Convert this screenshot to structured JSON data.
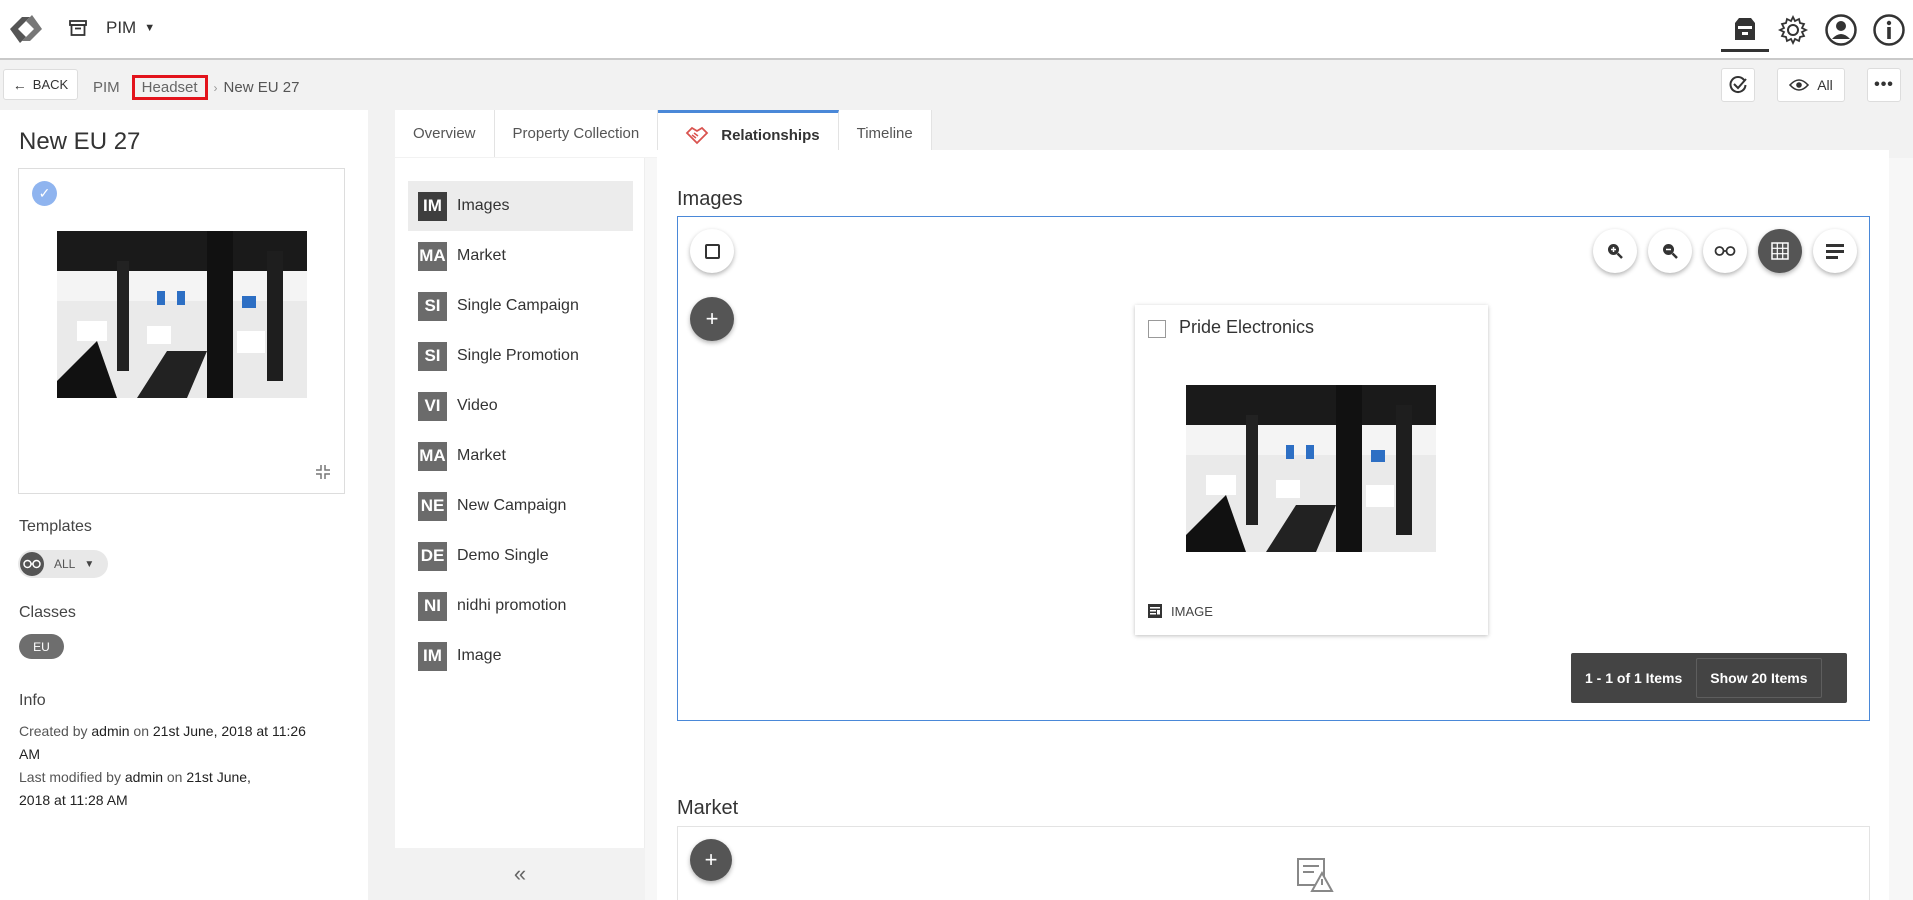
{
  "app": {
    "module": "PIM",
    "top_icons": [
      "inbox-tray-icon",
      "gear-icon",
      "user-icon",
      "info-icon"
    ]
  },
  "breadcrumb": {
    "back_label": "BACK",
    "items": [
      "PIM",
      "Headset",
      "New EU 27"
    ],
    "view_label": "All"
  },
  "left": {
    "title": "New EU 27",
    "templates_label": "Templates",
    "template_value": "ALL",
    "classes_label": "Classes",
    "class_value": "EU",
    "info_label": "Info",
    "created_prefix": "Created by",
    "created_by": "admin",
    "created_on": "on",
    "created_date": "21st June, 2018 at 11:26",
    "created_date_tail": "AM",
    "modified_prefix": "Last modified by",
    "modified_by": "admin",
    "modified_on": "on",
    "modified_date": "21st June,",
    "modified_date_tail": "2018 at 11:28 AM"
  },
  "tabs": [
    "Overview",
    "Property Collection",
    "Relationships",
    "Timeline"
  ],
  "relationships": [
    {
      "abbr": "IM",
      "name": "Images"
    },
    {
      "abbr": "MA",
      "name": "Market"
    },
    {
      "abbr": "SI",
      "name": "Single Campaign"
    },
    {
      "abbr": "SI",
      "name": "Single Promotion"
    },
    {
      "abbr": "VI",
      "name": "Video"
    },
    {
      "abbr": "MA",
      "name": "Market"
    },
    {
      "abbr": "NE",
      "name": "New Campaign"
    },
    {
      "abbr": "DE",
      "name": "Demo Single"
    },
    {
      "abbr": "NI",
      "name": "nidhi promotion"
    },
    {
      "abbr": "IM",
      "name": "Image"
    }
  ],
  "images_section": {
    "title": "Images",
    "card": {
      "title": "Pride Electronics",
      "type": "IMAGE"
    },
    "pager_count": "1 - 1 of 1 Items",
    "pager_show": "Show 20 Items"
  },
  "market_section": {
    "title": "Market"
  },
  "colors": {
    "accent": "#4a88d8",
    "highlight": "#e3141c",
    "dark": "#444444"
  }
}
